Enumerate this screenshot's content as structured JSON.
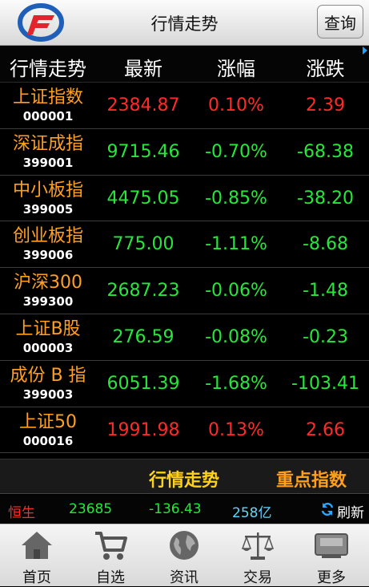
{
  "app": {
    "title": "行情走势",
    "query_label": "查询",
    "brand_colors": {
      "logo_blue": "#1f5fb8",
      "logo_red": "#e2252b"
    }
  },
  "table": {
    "headers": [
      "行情走势",
      "最新",
      "涨幅",
      "涨跌"
    ],
    "rows": [
      {
        "name": "上证指数",
        "code": "000001",
        "latest": "2384.87",
        "pct": "0.10%",
        "change": "2.39",
        "dir": "up"
      },
      {
        "name": "深证成指",
        "code": "399001",
        "latest": "9715.46",
        "pct": "-0.70%",
        "change": "-68.38",
        "dir": "down"
      },
      {
        "name": "中小板指",
        "code": "399005",
        "latest": "4475.05",
        "pct": "-0.85%",
        "change": "-38.20",
        "dir": "down"
      },
      {
        "name": "创业板指",
        "code": "399006",
        "latest": "775.00",
        "pct": "-1.11%",
        "change": "-8.68",
        "dir": "down"
      },
      {
        "name": "沪深300",
        "code": "399300",
        "latest": "2687.23",
        "pct": "-0.06%",
        "change": "-1.48",
        "dir": "down"
      },
      {
        "name": "上证B股",
        "code": "000003",
        "latest": "276.59",
        "pct": "-0.08%",
        "change": "-0.23",
        "dir": "down"
      },
      {
        "name": "成份 B 指",
        "code": "399003",
        "latest": "6051.39",
        "pct": "-1.68%",
        "change": "-103.41",
        "dir": "down"
      },
      {
        "name": "上证50",
        "code": "000016",
        "latest": "1991.98",
        "pct": "0.13%",
        "change": "2.66",
        "dir": "up"
      }
    ],
    "colors": {
      "up": "#ff2a2a",
      "down": "#25e83a",
      "name": "#ffa021"
    }
  },
  "tabs": {
    "active": "行情走势",
    "other": "重点指数"
  },
  "ticker": {
    "name": "恒生",
    "value": "23685",
    "change": "-136.43",
    "volume": "258亿",
    "refresh_label": "刷新"
  },
  "nav": {
    "items": [
      {
        "label": "首页",
        "icon": "home-icon"
      },
      {
        "label": "自选",
        "icon": "cart-icon"
      },
      {
        "label": "资讯",
        "icon": "globe-icon"
      },
      {
        "label": "交易",
        "icon": "scale-icon"
      },
      {
        "label": "更多",
        "icon": "more-icon"
      }
    ]
  }
}
